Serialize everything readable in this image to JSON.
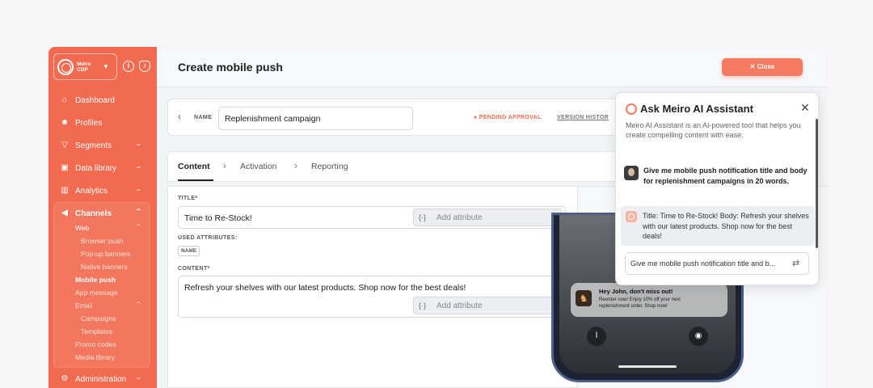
{
  "brand": {
    "logo_text": "Meiro CDP",
    "accent": "#f26a4f"
  },
  "sidebar": {
    "items": [
      {
        "label": "Dashboard",
        "icon": "home-icon"
      },
      {
        "label": "Profiles",
        "icon": "users-icon"
      },
      {
        "label": "Segments",
        "icon": "filter-icon"
      },
      {
        "label": "Data library",
        "icon": "library-icon"
      },
      {
        "label": "Analytics",
        "icon": "chart-icon"
      },
      {
        "label": "Channels",
        "icon": "megaphone-icon"
      }
    ],
    "channels": {
      "web": "Web",
      "browser_push": "Browser push",
      "popup_banners": "Pop-up banners",
      "native_banners": "Native banners",
      "mobile_push": "Mobile push",
      "app_message": "App message",
      "email": "Email",
      "campaigns": "Campaigns",
      "templates": "Templates",
      "promo_codes": "Promo codes",
      "media_library": "Media library"
    },
    "administration": "Administration"
  },
  "header": {
    "title": "Create mobile push",
    "close_label": "✕ Close"
  },
  "name_bar": {
    "label": "NAME",
    "value": "Replenishment campaign",
    "status": "● PENDING APPROVAL",
    "version_history": "VERSION HISTOR"
  },
  "tabs": [
    "Content",
    "Activation",
    "Reporting"
  ],
  "form": {
    "title_label": "TITLE*",
    "title_value": "Time to Re-Stock!",
    "add_attribute": "Add attribute",
    "used_attributes_label": "USED ATTRIBUTES:",
    "used_attribute_tag": "NAME",
    "content_label": "CONTENT*",
    "content_value": "Refresh your shelves with our latest products. Shop now for the best deals!"
  },
  "preview": {
    "notification_title": "Hey John, don't miss out!",
    "notification_body": "Reorder now! Enjoy 10% off your next replenishment order. Shop now!"
  },
  "assistant": {
    "title": "Ask Meiro AI Assistant",
    "description": "Meiro AI Assistant is an AI-powered tool that helps you create compelling content with ease.",
    "user_message": "Give me mobile push notification title and body for replenishment campaigns in 20 words.",
    "response": "Title: Time to Re-Stock! Body: Refresh your shelves with our latest products. Shop now for the best deals!",
    "input_value": "Give me mobile push notification title and b..."
  }
}
